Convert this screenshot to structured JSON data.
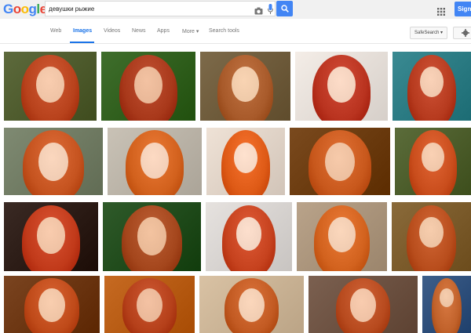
{
  "header": {
    "logo_letters": [
      {
        "ch": "G",
        "color": "#4285f4"
      },
      {
        "ch": "o",
        "color": "#ea4335"
      },
      {
        "ch": "o",
        "color": "#fbbc05"
      },
      {
        "ch": "g",
        "color": "#4285f4"
      },
      {
        "ch": "l",
        "color": "#34a853"
      },
      {
        "ch": "e",
        "color": "#ea4335"
      }
    ],
    "search_value": "девушки рыжие",
    "signin_label": "Sign"
  },
  "tabs": [
    {
      "label": "Web",
      "active": false
    },
    {
      "label": "Images",
      "active": true
    },
    {
      "label": "Videos",
      "active": false
    },
    {
      "label": "News",
      "active": false
    },
    {
      "label": "Apps",
      "active": false
    },
    {
      "label": "More ▾",
      "active": false
    },
    {
      "label": "Search tools",
      "active": false
    }
  ],
  "safesearch_label": "SafeSearch ▾",
  "colors": {
    "accent": "#4285f4",
    "hair": "#c8481e",
    "skin": "#f2c9ad"
  },
  "image_results": [
    {
      "bg": "#5d6a3c",
      "hair": "#b8421c",
      "skin": "#efc3a5"
    },
    {
      "bg": "#3f6e2c",
      "hair": "#a8381a",
      "skin": "#e9b898"
    },
    {
      "bg": "#7d6a4a",
      "hair": "#a85a2a",
      "skin": "#efcaa9"
    },
    {
      "bg": "#f4ede7",
      "hair": "#b9331f",
      "skin": "#f3d2be"
    },
    {
      "bg": "#3a8a92",
      "hair": "#b63a1e",
      "skin": "#f0c8ae"
    },
    {
      "bg": "#7f8a72",
      "hair": "#c5531f",
      "skin": "#f1cdb4"
    },
    {
      "bg": "#c9c2b6",
      "hair": "#d2611d",
      "skin": "#f3d0b9"
    },
    {
      "bg": "#efe2d6",
      "hair": "#de5a16",
      "skin": "#f6d8c5"
    },
    {
      "bg": "#7a4a1e",
      "hair": "#c8581c",
      "skin": "#edc0a0"
    },
    {
      "bg": "#5b6c3a",
      "hair": "#c94d1c",
      "skin": "#f0c7aa"
    },
    {
      "bg": "#3a2a24",
      "hair": "#c13a1a",
      "skin": "#efc2a4"
    },
    {
      "bg": "#2f5a2a",
      "hair": "#a4461c",
      "skin": "#e9b996"
    },
    {
      "bg": "#e6e2df",
      "hair": "#c6421e",
      "skin": "#f3d5c3"
    },
    {
      "bg": "#b9a38a",
      "hair": "#d2621e",
      "skin": "#f1cdb2"
    },
    {
      "bg": "#8a6a3a",
      "hair": "#b84d1c",
      "skin": "#edc3a3"
    },
    {
      "bg": "#7a4420",
      "hair": "#bf4a19",
      "skin": "#efc4a5"
    },
    {
      "bg": "#c66a22",
      "hair": "#b5401a",
      "skin": "#eab899"
    },
    {
      "bg": "#d9c2a4",
      "hair": "#c25a22",
      "skin": "#f1cdb2"
    },
    {
      "bg": "#7b6050",
      "hair": "#b74a1e",
      "skin": "#efc2a5"
    },
    {
      "bg": "#3d5e8a",
      "hair": "#c0612a",
      "skin": "#ecc3a3"
    }
  ]
}
